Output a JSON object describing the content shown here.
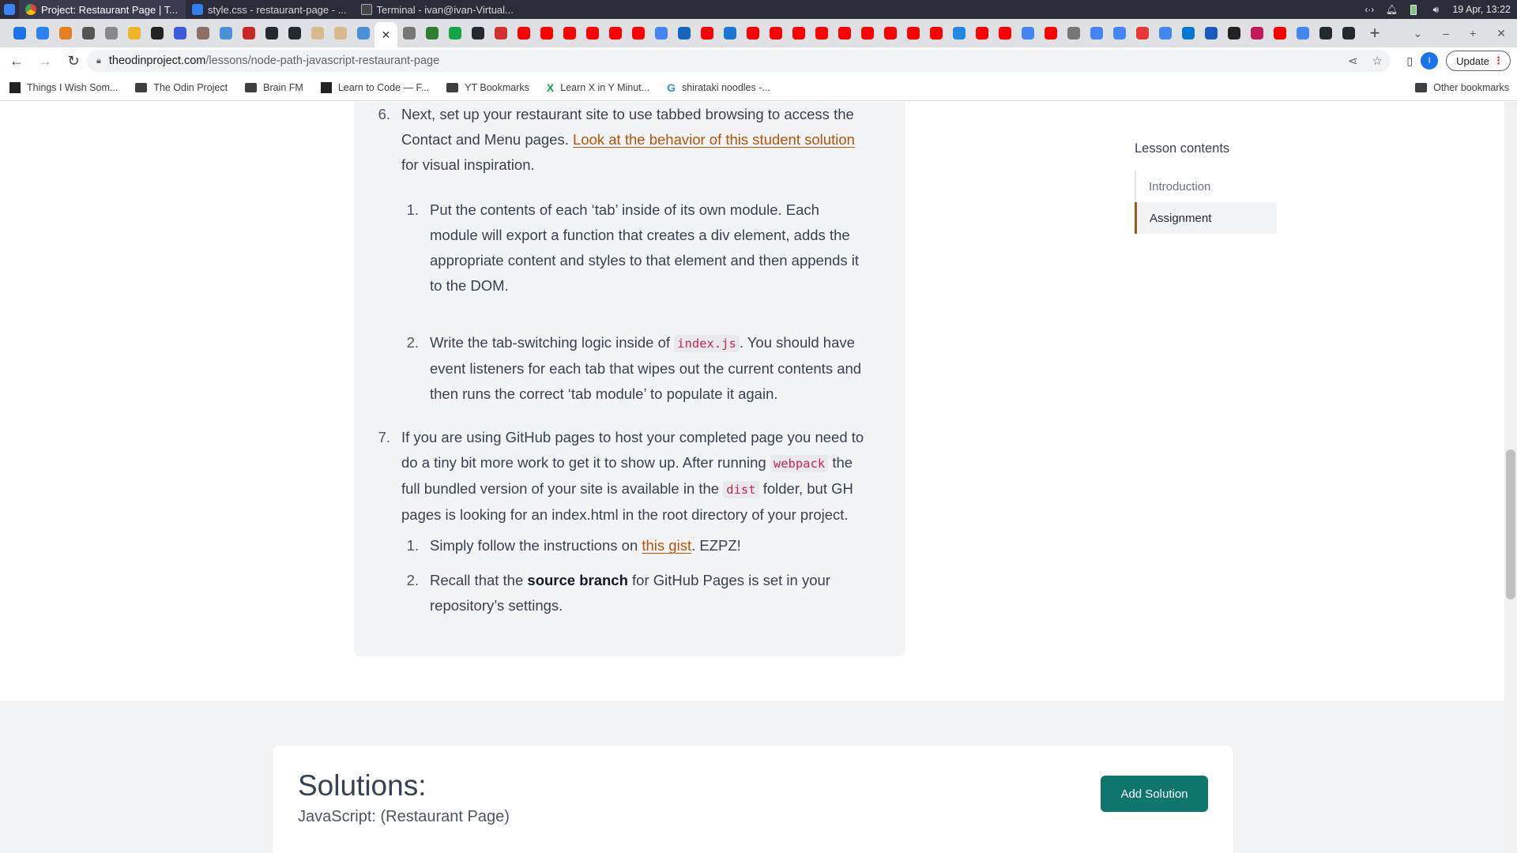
{
  "os": {
    "tasks": [
      {
        "label": "Project: Restaurant Page | T...",
        "icon": "chrome-icon",
        "active": true
      },
      {
        "label": "style.css - restaurant-page - ...",
        "icon": "vscode-icon",
        "active": false
      },
      {
        "label": "Terminal - ivan@ivan-Virtual...",
        "icon": "terminal-icon",
        "active": false
      }
    ],
    "clock": "19 Apr, 13:22"
  },
  "browser": {
    "favicon_tabs": [
      "#1a73e8",
      "#2f80ed",
      "#e67e22",
      "#555555",
      "#888888",
      "#f0b429",
      "#222222",
      "#3b5bdb",
      "#8d6e63",
      "#4a90d9",
      "#c62828",
      "#24292e",
      "#24292e",
      "#d7b98e",
      "#d7b98e",
      "#4a90d9",
      "active",
      "#777777",
      "#2e7d32",
      "#16a34a",
      "#24292e",
      "#d32f2f",
      "#ff0000",
      "#ff0000",
      "#ff0000",
      "#ff0000",
      "#ff0000",
      "#ff0000",
      "#4285f4",
      "#1565c0",
      "#ff0000",
      "#1976d2",
      "#ff0000",
      "#ff0000",
      "#ff0000",
      "#ff0000",
      "#ff0000",
      "#ff0000",
      "#ff0000",
      "#ff0000",
      "#ff0000",
      "#1e88e5",
      "#ff0000",
      "#ff0000",
      "#4285f4",
      "#ff0000",
      "#777777",
      "#4285f4",
      "#4285f4",
      "#e53935",
      "#4285f4",
      "#0078d4",
      "#185abd",
      "#222222",
      "#c2185b",
      "#ff0000",
      "#4285f4",
      "#24292e",
      "#24292e"
    ],
    "url_host": "theodinproject.com",
    "url_path": "/lessons/node-path-javascript-restaurant-page",
    "update_label": "Update",
    "profile_initial": "I",
    "bookmarks": [
      {
        "label": "Things I Wish Som...",
        "icon": "letter-a-icon"
      },
      {
        "label": "The Odin Project",
        "icon": "folder-icon"
      },
      {
        "label": "Brain FM",
        "icon": "folder-icon"
      },
      {
        "label": "Learn to Code — F...",
        "icon": "letter-a-icon"
      },
      {
        "label": "YT Bookmarks",
        "icon": "folder-icon"
      },
      {
        "label": "Learn X in Y Minut...",
        "icon": "x-icon"
      },
      {
        "label": "shirataki noodles -...",
        "icon": "google-icon"
      }
    ],
    "other_bookmarks": "Other bookmarks"
  },
  "lesson": {
    "item6": {
      "num": "6.",
      "text_a": "Next, set up your restaurant site to use tabbed browsing to access the",
      "text_b": "Contact and Menu pages. ",
      "link": "Look at the behavior of this student solution",
      "text_c": "for visual inspiration."
    },
    "item6_1": {
      "num": "1.",
      "lines": [
        "Put the contents of each ‘tab’ inside of its own module. Each",
        "module will export a function that creates a div element, adds the",
        "appropriate content and styles to that element and then appends it",
        "to the DOM."
      ]
    },
    "item6_2": {
      "num": "2.",
      "pre": "Write the tab-switching logic inside of ",
      "code": "index.js",
      "post": ". You should have",
      "line2": "event listeners for each tab that wipes out the current contents and",
      "line3": "then runs the correct ‘tab module’ to populate it again."
    },
    "item7": {
      "num": "7.",
      "line1": "If you are using GitHub pages to host your completed page you need to",
      "line2_pre": "do a tiny bit more work to get it to show up. After running ",
      "code1": "webpack",
      "line2_post": " the",
      "line3_pre": "full bundled version of your site is available in the ",
      "code2": "dist",
      "line3_post": " folder, but GH",
      "line4": "pages is looking for an index.html in the root directory of your project."
    },
    "item7_1": {
      "num": "1.",
      "pre": "Simply follow the instructions on ",
      "link": "this gist",
      "post": ". EZPZ!"
    },
    "item7_2": {
      "num": "2.",
      "pre": "Recall that the ",
      "bold": "source branch",
      "post": " for GitHub Pages is set in your",
      "line2": "repository’s settings."
    }
  },
  "toc": {
    "title": "Lesson contents",
    "items": [
      {
        "label": "Introduction",
        "active": false
      },
      {
        "label": "Assignment",
        "active": true
      }
    ]
  },
  "solutions": {
    "title": "Solutions:",
    "subtitle": "JavaScript: (Restaurant Page)",
    "add_label": "Add Solution"
  },
  "colors": {
    "accent_link": "#b45309",
    "button": "#0f766e"
  }
}
